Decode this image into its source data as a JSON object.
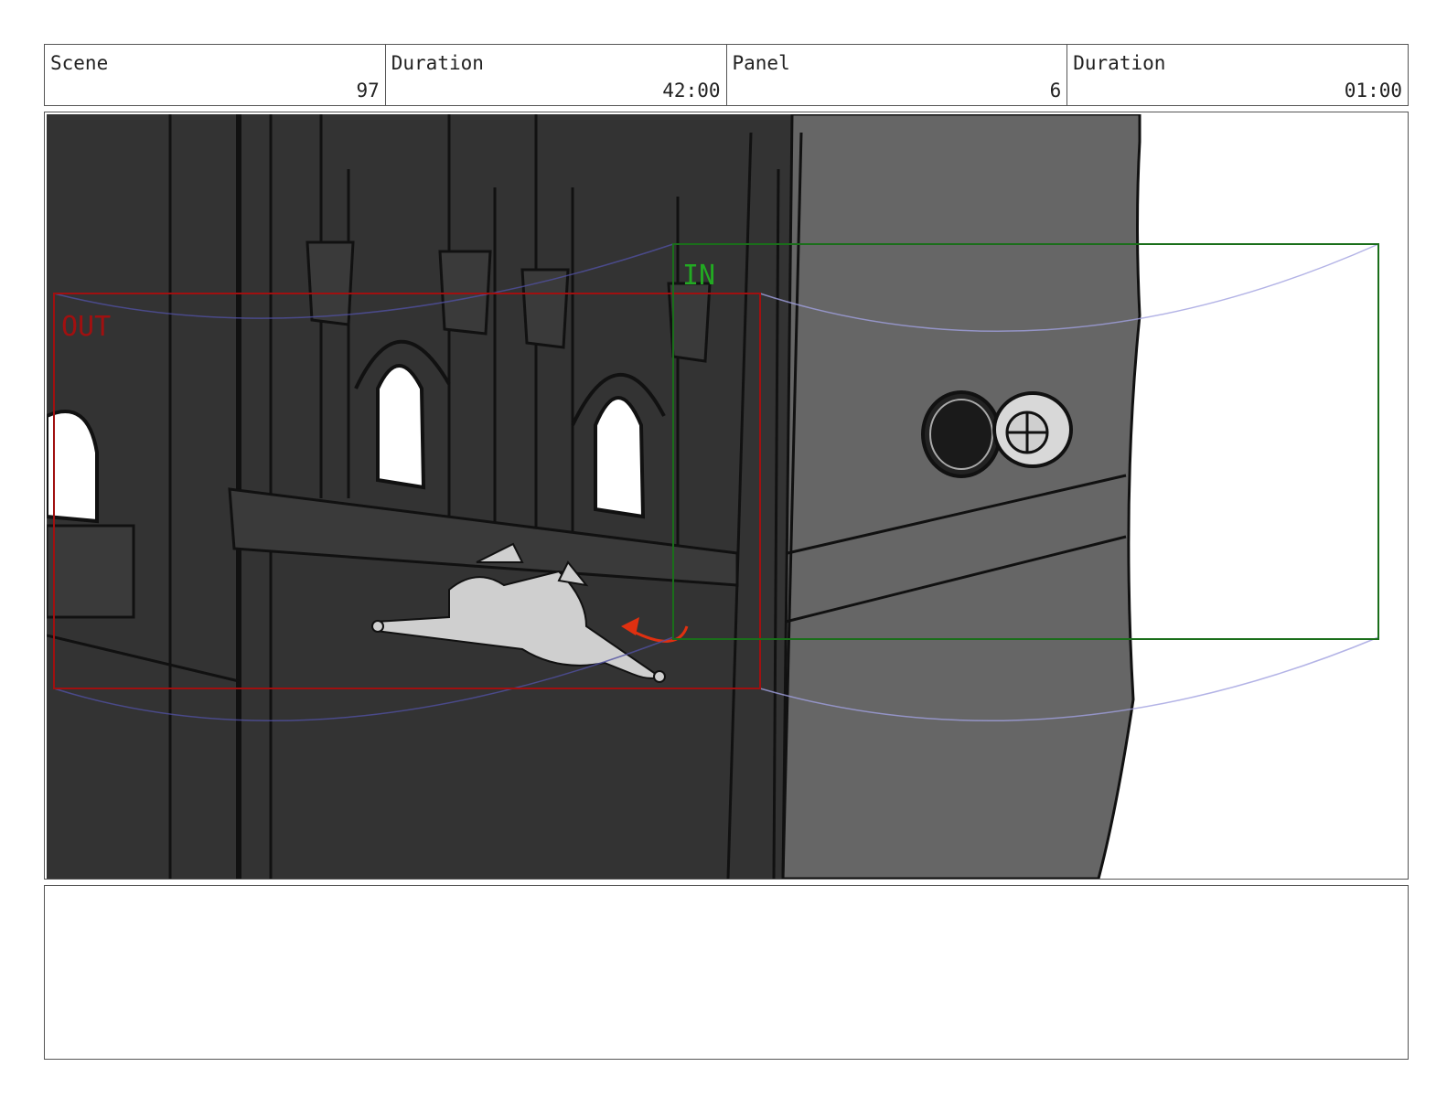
{
  "header": {
    "scene_label": "Scene",
    "scene_value": "97",
    "scene_duration_label": "Duration",
    "scene_duration_value": "42:00",
    "panel_label": "Panel",
    "panel_value": "6",
    "panel_duration_label": "Duration",
    "panel_duration_value": "01:00"
  },
  "frame": {
    "out_label": "OUT",
    "in_label": "IN"
  },
  "colors": {
    "out_box": "#a01010",
    "in_box": "#1a6e1a",
    "in_text": "#22aa22",
    "motion_arrow": "#e03010",
    "camera_path": "#5050a0"
  },
  "notes": {
    "text": ""
  }
}
